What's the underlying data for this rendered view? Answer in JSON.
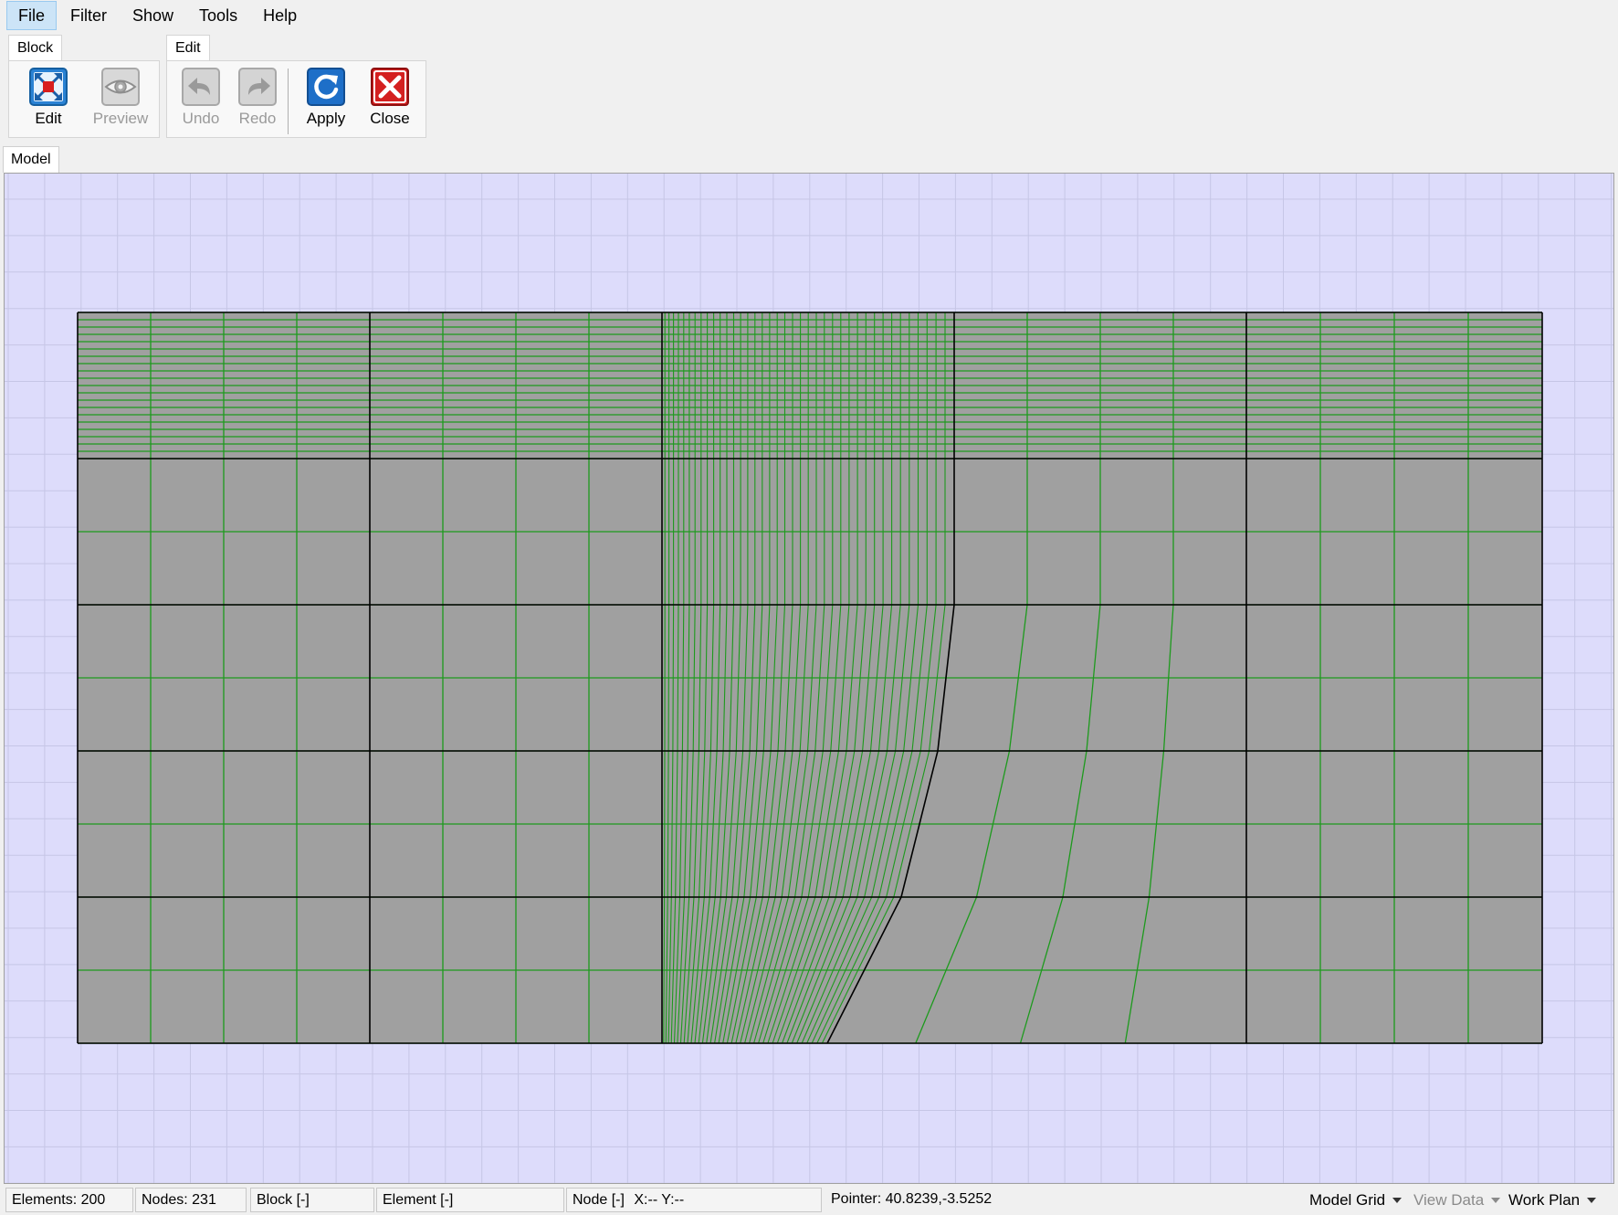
{
  "menu": {
    "items": [
      "File",
      "Filter",
      "Show",
      "Tools",
      "Help"
    ],
    "active": "File"
  },
  "ribbon": {
    "block_group": {
      "title": "Block",
      "edit_label": "Edit",
      "preview_label": "Preview"
    },
    "edit_group": {
      "title": "Edit",
      "undo_label": "Undo",
      "redo_label": "Redo",
      "apply_label": "Apply",
      "close_label": "Close"
    }
  },
  "document_tab": {
    "label": "Model"
  },
  "icons": {
    "edit": "edit-block-icon",
    "preview": "preview-eye-icon",
    "undo": "undo-arrow-icon",
    "redo": "redo-arrow-icon",
    "apply": "apply-refresh-icon",
    "close": "close-x-icon"
  },
  "colors": {
    "canvas_background": "#dddcfb",
    "mesh_fill": "#a0a0a0",
    "mesh_lines": "#1d9a1d",
    "block_boundaries": "#000000",
    "apply_accent": "#1e6fc8",
    "close_accent": "#d42020"
  },
  "status": {
    "elements": "Elements: 200",
    "nodes": "Nodes: 231",
    "block": "Block [-]",
    "element": "Element [-]",
    "node": "Node [-]",
    "xy": "X:-- Y:--",
    "pointer": "Pointer: 40.8239,-3.5252",
    "model_grid": "Model Grid",
    "view_data": "View Data",
    "work_plan": "Work Plan"
  }
}
